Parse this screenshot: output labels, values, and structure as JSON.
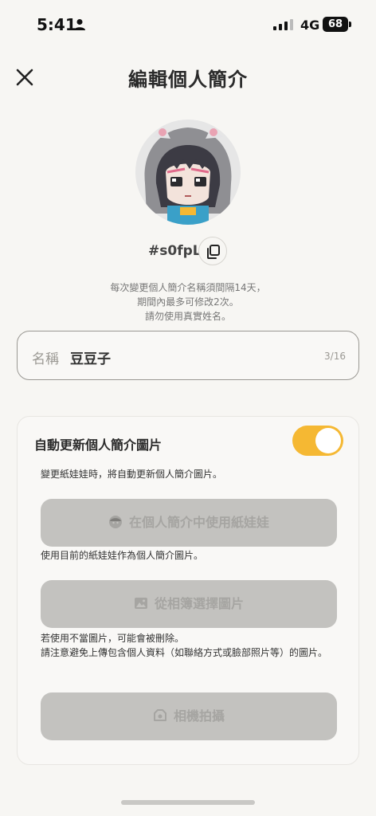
{
  "status": {
    "time": "5:41",
    "network": "4G",
    "battery": "68"
  },
  "header": {
    "title": "編輯個人簡介"
  },
  "profile": {
    "id": "#s0fpL",
    "notice": [
      "每次變更個人簡介名稱須間隔14天，",
      "期間內最多可修改2次。",
      "請勿使用真實姓名。"
    ]
  },
  "name_field": {
    "label": "名稱",
    "value": "豆豆子",
    "count": "3/16"
  },
  "auto_update": {
    "title": "自動更新個人簡介圖片",
    "enabled": true,
    "description": "變更紙娃娃時，將自動更新個人簡介圖片。"
  },
  "buttons": {
    "use_avatar": "在個人簡介中使用紙娃娃",
    "use_avatar_hint": "使用目前的紙娃娃作為個人簡介圖片。",
    "from_album": "從相簿選擇圖片",
    "from_album_hint": [
      "若使用不當圖片，可能會被刪除。",
      "請注意避免上傳包含個人資料（如聯絡方式或臉部照片等）的圖片。"
    ],
    "camera": "相機拍攝"
  },
  "colors": {
    "accent": "#f5b833",
    "disabled_button": "#c3c2bf",
    "background": "#f7f6f3"
  }
}
